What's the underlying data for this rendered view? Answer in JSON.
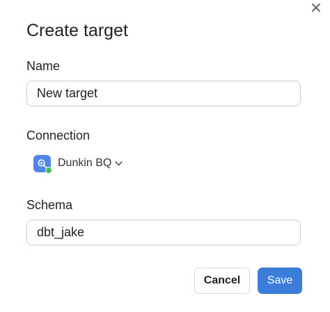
{
  "dialog": {
    "title": "Create target"
  },
  "name_field": {
    "label": "Name",
    "value": "New target"
  },
  "connection": {
    "label": "Connection",
    "selected": "Dunkin BQ",
    "icon": "bigquery-icon",
    "status": "connected",
    "status_color": "#3ebd5b"
  },
  "schema_field": {
    "label": "Schema",
    "value": "dbt_jake"
  },
  "actions": {
    "cancel_label": "Cancel",
    "save_label": "Save"
  },
  "colors": {
    "accent": "#3b7dd8",
    "connection_icon_bg": "#4f86e8"
  }
}
